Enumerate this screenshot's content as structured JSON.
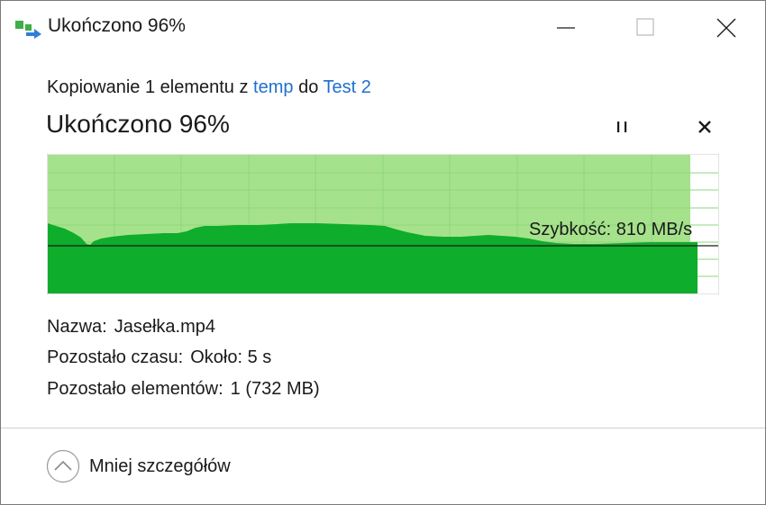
{
  "window": {
    "title": "Ukończono 96%"
  },
  "header": {
    "copy_prefix": "Kopiowanie 1 elementu z",
    "source": "temp",
    "to_word": "do",
    "destination": "Test 2",
    "status": "Ukończono 96%"
  },
  "progress": {
    "percent": 96,
    "speed_label": "Szybkość: 810 MB/s"
  },
  "details": {
    "name_label": "Nazwa:",
    "name_value": "Jasełka.mp4",
    "time_label": "Pozostało czasu:",
    "time_value": "Około: 5 s",
    "items_label": "Pozostało elementów:",
    "items_value": "1 (732 MB)"
  },
  "footer": {
    "less_details_label": "Mniej szczegółów"
  },
  "colors": {
    "graph_fill": "#0ead2b",
    "graph_light": "#a6e28c",
    "graph_grid": "#8ed87a",
    "link": "#1f6fcf"
  },
  "icons": {
    "app": "copy-arrow-icon",
    "minimize": "minimize-icon",
    "maximize": "maximize-icon",
    "close": "close-icon",
    "pause": "pause-icon",
    "cancel": "cancel-icon",
    "less": "chevron-up-circle-icon"
  }
}
